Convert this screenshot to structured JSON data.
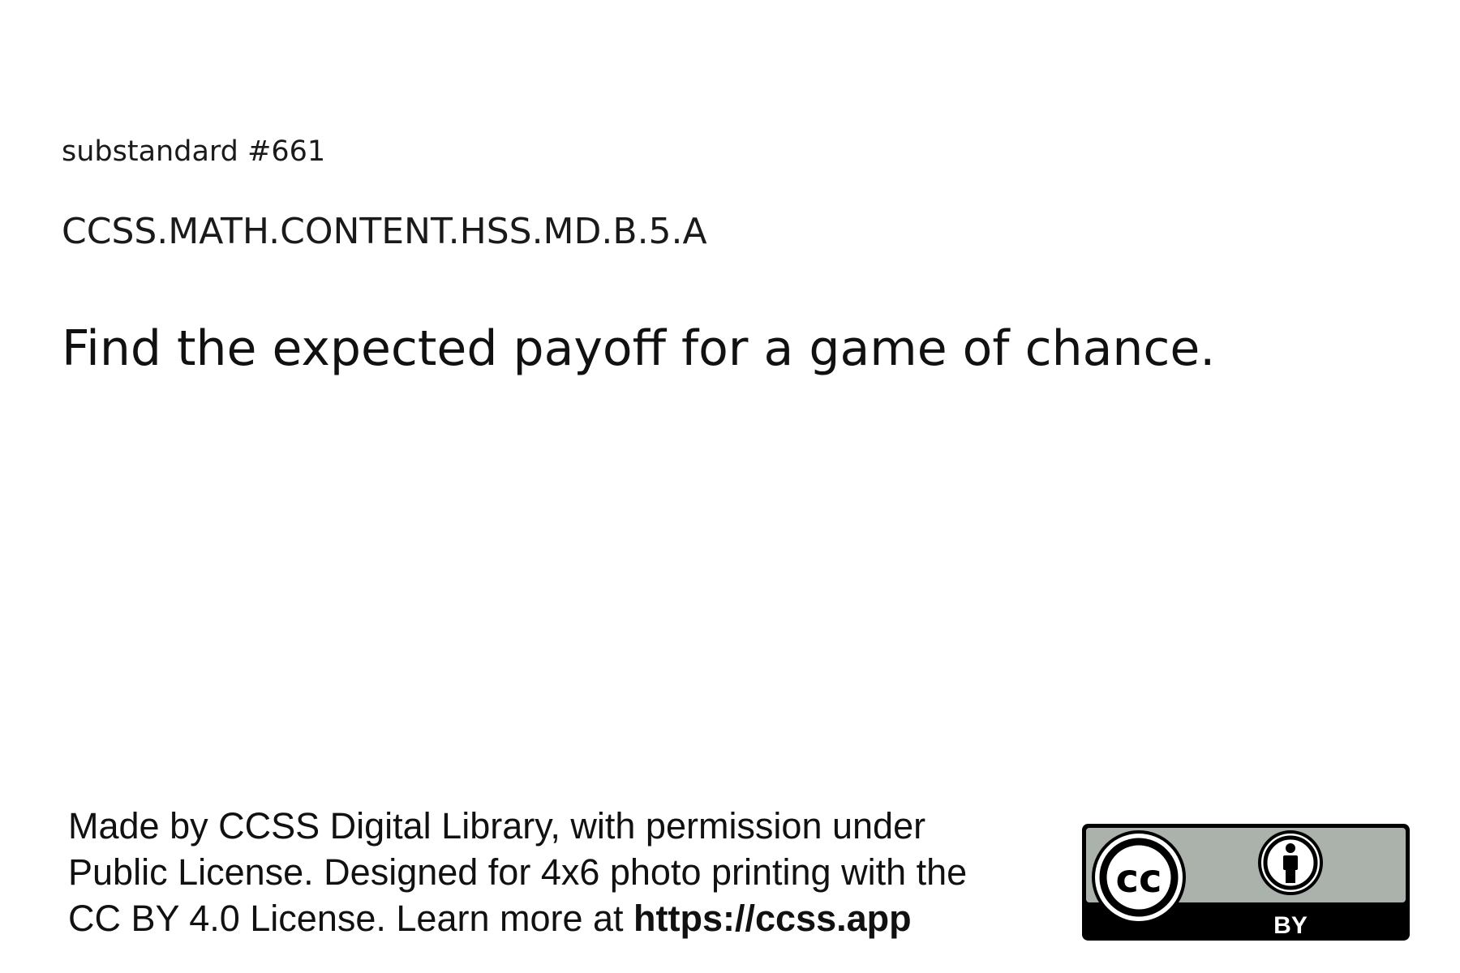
{
  "card": {
    "substandard_label": "substandard #661",
    "standard_code": "CCSS.MATH.CONTENT.HSS.MD.B.5.A",
    "headline": "Find the expected payoff for a game of chance."
  },
  "footer": {
    "line1": "Made by CCSS Digital Library, with permission under",
    "line2": "Public License. Designed for 4x6 photo printing with the",
    "line3_prefix": "CC BY 4.0 License. Learn more at ",
    "link_text": "https://ccss.app"
  },
  "license_badge": {
    "logo_text": "cc",
    "by_label": "BY",
    "colors": {
      "badge_gray": "#aab2ab",
      "badge_black": "#000000",
      "badge_white": "#ffffff"
    }
  }
}
